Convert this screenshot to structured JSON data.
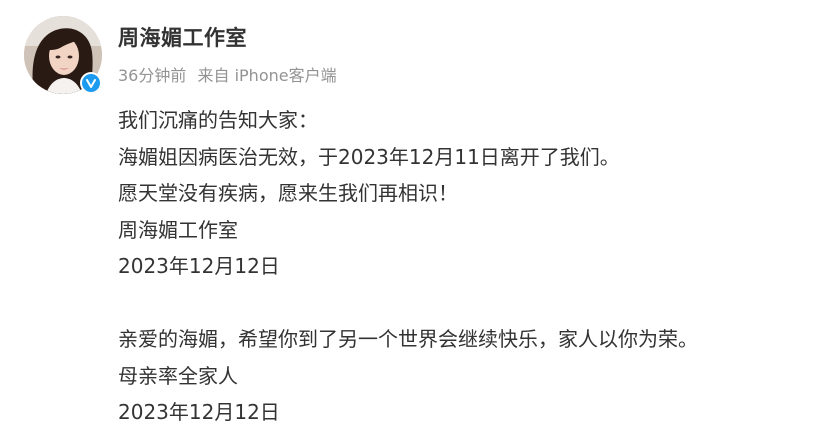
{
  "post": {
    "author": "周海媚工作室",
    "time": "36分钟前",
    "source_prefix": "来自",
    "source": "iPhone客户端",
    "lines": [
      "我们沉痛的告知大家：",
      "海媚姐因病医治无效，于2023年12月11日离开了我们。",
      "愿天堂没有疾病，愿来生我们再相识！",
      "周海媚工作室",
      "2023年12月12日",
      "",
      "亲爱的海媚，希望你到了另一个世界会继续快乐，家人以你为荣。",
      "母亲率全家人",
      "2023年12月12日"
    ]
  },
  "colors": {
    "text": "#333333",
    "meta": "#939393",
    "verified_badge": "#1d9bf0",
    "background": "#ffffff"
  },
  "icons": {
    "verified": "verified-badge-icon",
    "avatar": "user-avatar-photo"
  }
}
